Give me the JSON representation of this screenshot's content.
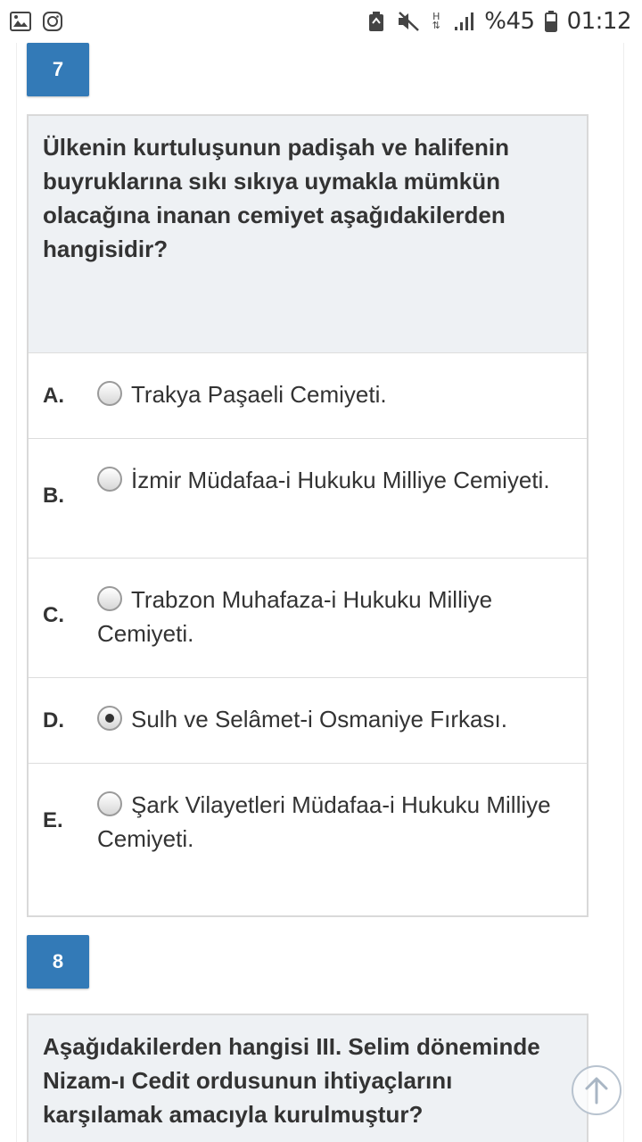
{
  "status_bar": {
    "battery": "%45",
    "time": "01:12",
    "network": "H",
    "icons": [
      "gallery-icon",
      "instagram-icon",
      "battery-saver-icon",
      "mute-icon",
      "network-h-icon",
      "signal-icon",
      "battery-icon"
    ]
  },
  "questions": [
    {
      "number": "7",
      "prompt": "Ülkenin kurtuluşunun padişah ve halifenin buyruklarına sıkı sıkıya uymakla mümkün olacağına inanan cemiyet aşağıdakilerden hangisidir?",
      "selected": "D",
      "options": [
        {
          "letter": "A.",
          "text": "Trakya Paşaeli Cemiyeti."
        },
        {
          "letter": "B.",
          "text": "İzmir Müdafaa-i Hukuku Milliye Cemiyeti."
        },
        {
          "letter": "C.",
          "text": "Trabzon Muhafaza-i Hukuku Milliye Cemiyeti."
        },
        {
          "letter": "D.",
          "text": "Sulh ve Selâmet-i Osmaniye Fırkası."
        },
        {
          "letter": "E.",
          "text": "Şark Vilayetleri Müdafaa-i Hukuku Milliye Cemiyeti."
        }
      ]
    },
    {
      "number": "8",
      "prompt": "Aşağıdakilerden hangisi III. Selim döneminde Nizam-ı Cedit ordusunun ihtiyaçlarını karşılamak amacıyla kurulmuştur?"
    }
  ],
  "colors": {
    "accent": "#337ab7",
    "prompt_bg": "#eef1f4",
    "border": "#d9d9d9",
    "text": "#333333"
  }
}
